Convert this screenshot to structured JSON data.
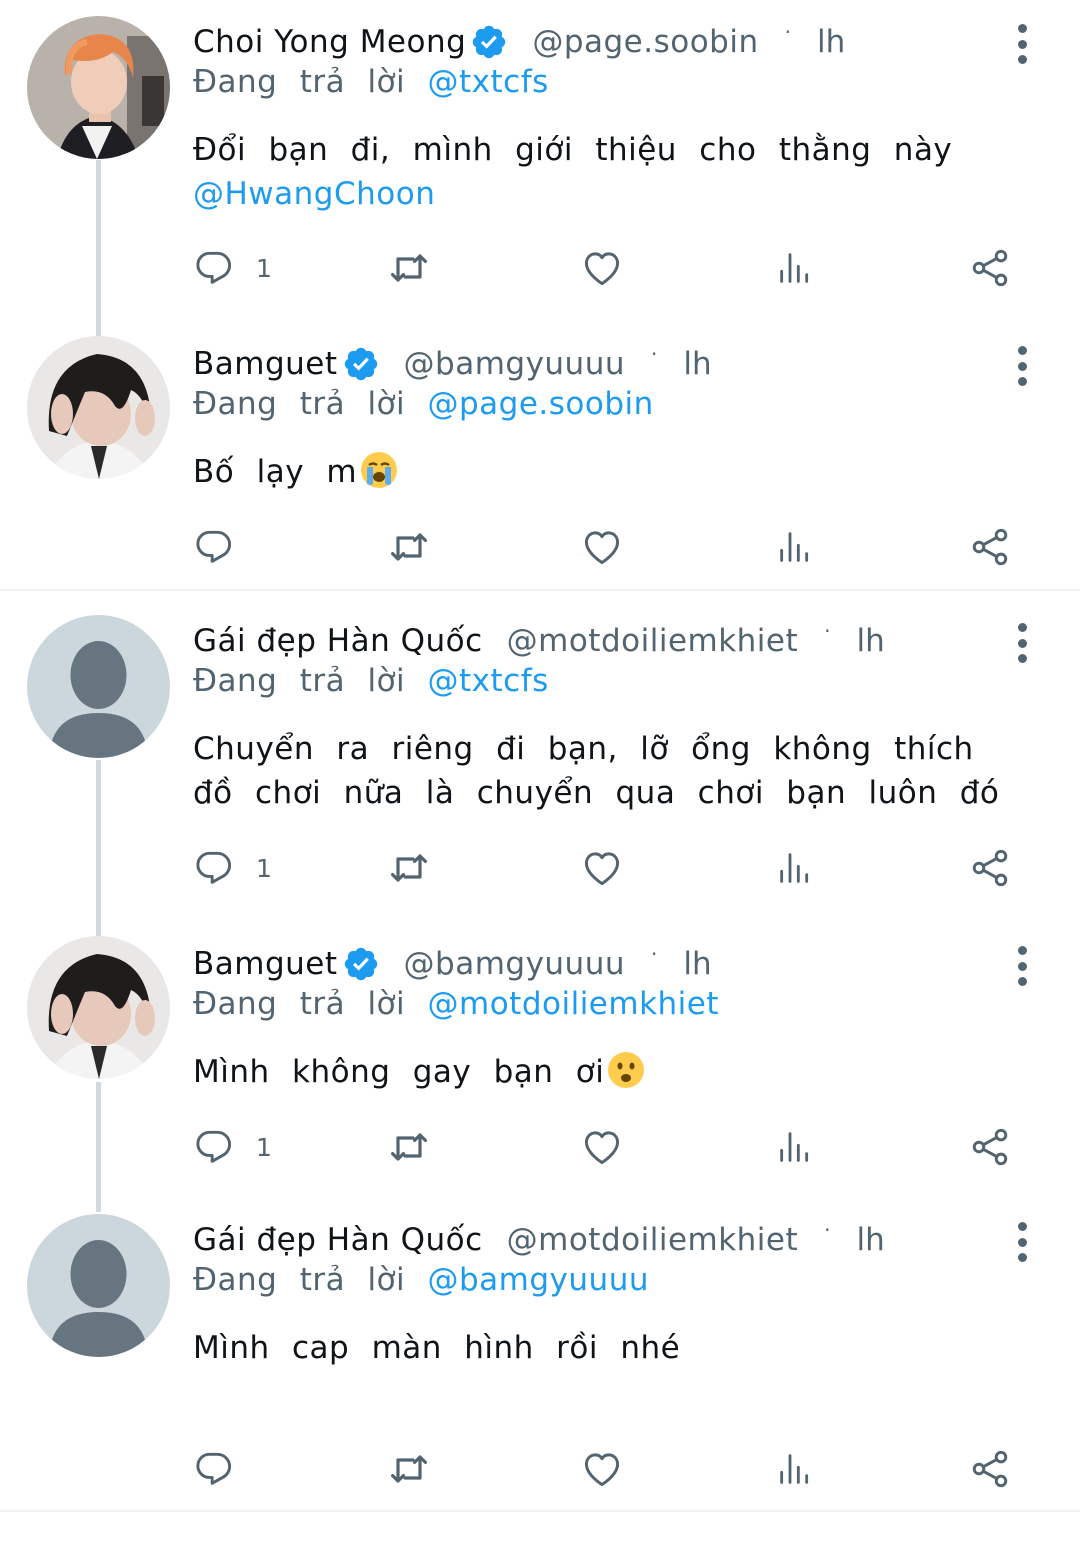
{
  "colors": {
    "accent": "#1d9bf0",
    "secondary_text": "#536471",
    "thread_line": "#cfd9de"
  },
  "tweets": [
    {
      "name": "Choi Yong Meong",
      "verified": true,
      "handle": "@page.soobin",
      "time": "lh",
      "reply_prefix": "Đang trả lời",
      "reply_to": "@txtcfs",
      "text": "Đổi bạn đi, mình giới thiệu cho thằng này",
      "text_mention": "@HwangChoon",
      "reply_count": "1",
      "avatar": "photo-orange-hair"
    },
    {
      "name": "Bamguet",
      "verified": true,
      "handle": "@bamgyuuuu",
      "time": "lh",
      "reply_prefix": "Đang trả lời",
      "reply_to": "@page.soobin",
      "text": "Bố lạy m",
      "emoji": "loudly-crying-face",
      "reply_count": "",
      "avatar": "photo-dark-hair"
    },
    {
      "name": "Gái đẹp Hàn Quốc",
      "verified": false,
      "handle": "@motdoiliemkhiet",
      "time": "lh",
      "reply_prefix": "Đang trả lời",
      "reply_to": "@txtcfs",
      "text": "Chuyển ra riêng đi bạn, lỡ ổng không thích đồ chơi nữa là chuyển qua chơi bạn luôn đó",
      "reply_count": "1",
      "avatar": "default-avatar"
    },
    {
      "name": "Bamguet",
      "verified": true,
      "handle": "@bamgyuuuu",
      "time": "lh",
      "reply_prefix": "Đang trả lời",
      "reply_to": "@motdoiliemkhiet",
      "text": "Mình không gay bạn ơi",
      "emoji": "frowning-face",
      "reply_count": "1",
      "avatar": "photo-dark-hair"
    },
    {
      "name": "Gái đẹp Hàn Quốc",
      "verified": false,
      "handle": "@motdoiliemkhiet",
      "time": "lh",
      "reply_prefix": "Đang trả lời",
      "reply_to": "@bamgyuuuu",
      "text": "Mình cap màn hình rồi nhé",
      "reply_count": "",
      "avatar": "default-avatar"
    }
  ],
  "action_icons": [
    "reply-icon",
    "retweet-icon",
    "like-icon",
    "views-icon",
    "share-icon"
  ]
}
